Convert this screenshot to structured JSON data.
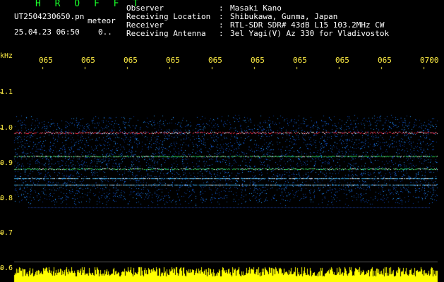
{
  "header": {
    "app_name": "H R O F F T",
    "file_name": "UT2504230650.pn",
    "meteor_label": "meteor",
    "date_time": "25.04.23 06:50",
    "count": "0..",
    "fields": [
      {
        "label": "Observer",
        "sep": ":",
        "value": "Masaki Kano"
      },
      {
        "label": "Receiving Location",
        "sep": ":",
        "value": "Shibukawa, Gunma, Japan"
      },
      {
        "label": "Receiver",
        "sep": ":",
        "value": "RTL-SDR SDR# 43dB L15 103.2MHz CW"
      },
      {
        "label": "Receiving Antenna",
        "sep": ":",
        "value": "3el Yagi(V) Az 330 for Vladivostok"
      }
    ]
  },
  "spectrogram": {
    "y_unit": "kHz",
    "y_ticks": [
      "1.1",
      "1.0",
      "0.9",
      "0.8",
      "0.7",
      "0.6"
    ],
    "x_ticks": [
      "065",
      "065",
      "065",
      "065",
      "065",
      "065",
      "065",
      "065",
      "065",
      "0700"
    ],
    "colors": {
      "background": "#000000",
      "label": "#ffee44",
      "noise_low": "#0a3aa0",
      "noise_high": "#2aa0ff",
      "signal": "#ff2a4a",
      "signal_green": "#30e060",
      "level": "#ffff00"
    }
  }
}
